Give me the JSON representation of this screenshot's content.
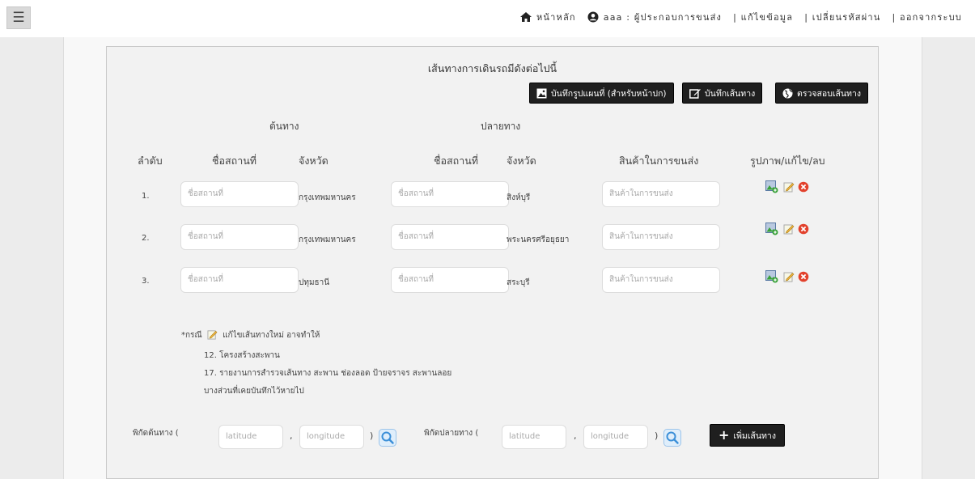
{
  "topbar": {
    "home_label": "หน้าหลัก",
    "user_label": "aaa : ผู้ประกอบการขนส่ง",
    "edit_profile_label": "| แก้ไขข้อมูล",
    "change_password_label": "| เปลี่ยนรหัสผ่าน",
    "logout_label": "| ออกจากระบบ"
  },
  "panel": {
    "title": "เส้นทางการเดินรถมีดังต่อไปนี้",
    "save_map_button": "บันทึกรูปแผนที่ (สำหรับหน้าปก)",
    "save_route_button": "บันทึกเส้นทาง",
    "check_route_button": "ตรวจสอบเส้นทาง"
  },
  "groups": {
    "origin": "ต้นทาง",
    "destination": "ปลายทาง"
  },
  "columns": {
    "order": "ลำดับ",
    "origin_place": "ชื่อสถานที่",
    "origin_province": "จังหวัด",
    "dest_place": "ชื่อสถานที่",
    "dest_province": "จังหวัด",
    "goods": "สินค้าในการขนส่ง",
    "actions": "รูปภาพ/แก้ไข/ลบ"
  },
  "rows": [
    {
      "num": "1.",
      "origin_place_placeholder": "ชื่อสถานที่",
      "origin_province": "กรุงเทพมหานคร",
      "dest_place_placeholder": "ชื่อสถานที่",
      "dest_province": "สิงห์บุรี",
      "goods_placeholder": "สินค้าในการขนส่ง"
    },
    {
      "num": "2.",
      "origin_place_placeholder": "ชื่อสถานที่",
      "origin_province": "กรุงเทพมหานคร",
      "dest_place_placeholder": "ชื่อสถานที่",
      "dest_province": "พระนครศรีอยุธยา",
      "goods_placeholder": "สินค้าในการขนส่ง"
    },
    {
      "num": "3.",
      "origin_place_placeholder": "ชื่อสถานที่",
      "origin_province": "ปทุมธานี",
      "dest_place_placeholder": "ชื่อสถานที่",
      "dest_province": "สระบุรี",
      "goods_placeholder": "สินค้าในการขนส่ง"
    }
  ],
  "notes": {
    "line1_prefix": "*กรณี",
    "line1_suffix": "แก้ไขเส้นทางใหม่ อาจทำให้",
    "line2": "12. โครงสร้างสะพาน",
    "line3": "17. รายงานการสำรวจเส้นทาง สะพาน ช่องลอด ป้ายจราจร สะพานลอย",
    "line4": "บางส่วนที่เคยบันทึกไว้หายไป"
  },
  "coords": {
    "origin_label": "พิกัดต้นทาง (",
    "dest_label": "พิกัดปลายทาง (",
    "latitude_placeholder": "latitude",
    "longitude_placeholder": "longitude",
    "comma": ",",
    "close_paren": ")",
    "add_route_button": "เพิ่มเส้นทาง"
  },
  "colors": {
    "button_dark": "#1f1f1f",
    "search_blue": "#3b8fd8",
    "delete_red": "#e2412c",
    "image_green": "#3aa23a"
  }
}
